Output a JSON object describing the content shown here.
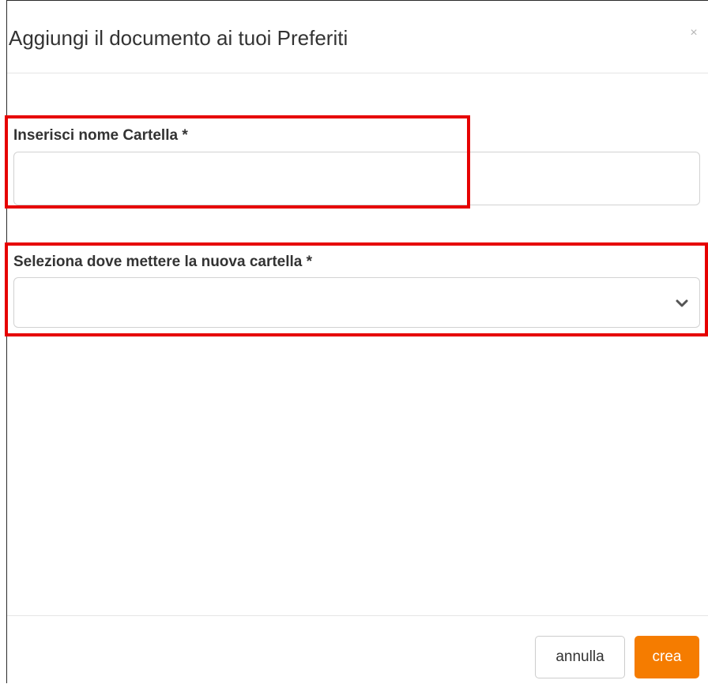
{
  "modal": {
    "title": "Aggiungi il documento ai tuoi Preferiti",
    "close_label": "×"
  },
  "form": {
    "folder_name": {
      "label": "Inserisci nome Cartella *",
      "value": "",
      "placeholder": ""
    },
    "destination": {
      "label": "Seleziona dove mettere la nuova cartella *",
      "selected_value": ""
    }
  },
  "footer": {
    "cancel_label": "annulla",
    "create_label": "crea"
  },
  "colors": {
    "accent": "#f57c00",
    "highlight": "#e60000",
    "border": "#d2d2d2"
  },
  "icons": {
    "close": "close-icon",
    "select_caret": "chevron-down-icon"
  }
}
